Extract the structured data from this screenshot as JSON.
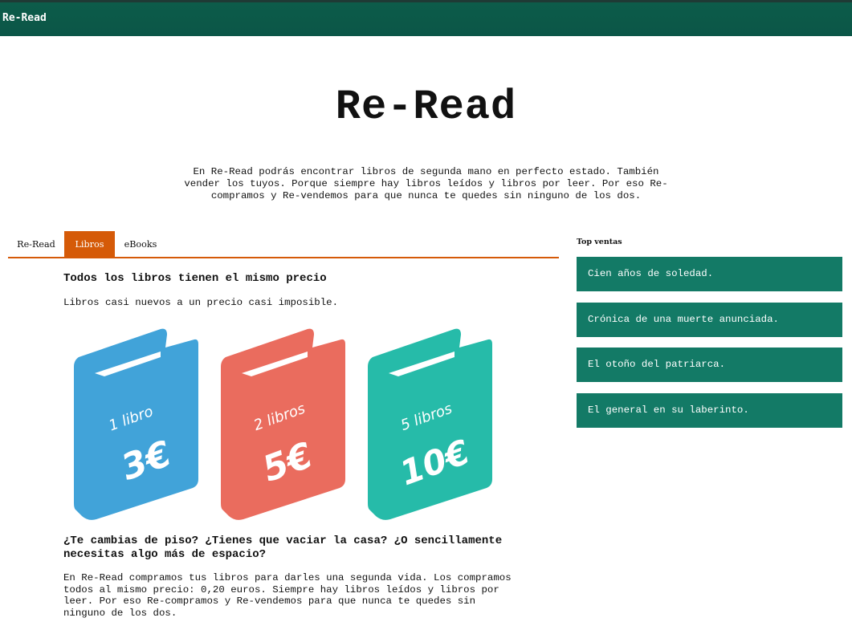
{
  "header": {
    "brand": "Re-Read"
  },
  "hero": {
    "title": "Re-Read",
    "text": "En Re-Read podrás encontrar libros de segunda mano en perfecto estado. También vender los tuyos. Porque siempre hay libros leídos y libros por leer. Por eso Re-compramos y Re-vendemos para que nunca te quedes sin ninguno de los dos."
  },
  "tabs": [
    {
      "label": "Re-Read",
      "active": false
    },
    {
      "label": "Libros",
      "active": true
    },
    {
      "label": "eBooks",
      "active": false
    }
  ],
  "main": {
    "heading1": "Todos los libros tienen el mismo precio",
    "subtitle": "Libros casi nuevos a un precio casi imposible.",
    "books": [
      {
        "qty": "1 libro",
        "price": "3€",
        "color": "#41a3d9"
      },
      {
        "qty": "2 libros",
        "price": "5€",
        "color": "#ea6c5e"
      },
      {
        "qty": "5 libros",
        "price": "10€",
        "color": "#26bba9"
      }
    ],
    "heading2": "¿Te cambias de piso? ¿Tienes que vaciar la casa? ¿O sencillamente necesitas algo más de espacio?",
    "paragraph": "En Re-Read compramos tus libros para darles una segunda vida. Los compramos todos al mismo precio: 0,20 euros. Siempre hay libros leídos y libros por leer. Por eso Re-compramos y Re-vendemos para que nunca te quedes sin ninguno de los dos."
  },
  "sidebar": {
    "title": "Top ventas",
    "items": [
      "Cien años de soledad.",
      "Crónica de una muerte anunciada.",
      "El otoño del patriarca.",
      "El general en su laberinto."
    ]
  },
  "colors": {
    "header": "#0b5647",
    "accent": "#d55a08",
    "sidebar_item": "#137a66"
  }
}
